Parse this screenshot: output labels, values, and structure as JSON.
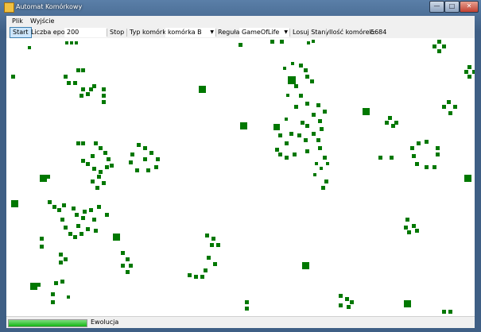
{
  "window": {
    "title": "Automat Komórkowy",
    "minimize_glyph": "—",
    "maximize_glyph": "□",
    "close_glyph": "✕"
  },
  "menu": {
    "items": [
      "Plik",
      "Wyjście"
    ]
  },
  "toolbar": {
    "start_label": "Start",
    "epochs_label": "Liczba epok:",
    "epochs_value": "200",
    "stop_label": "Stop",
    "cell_type_label": "Typ komórki:",
    "cell_type_value": "komórka B",
    "rule_label": "Reguła:",
    "rule_value": "GameOfLife",
    "randomize_label": "Losuj Stany",
    "cell_count_label": "Ilość komórek:",
    "cell_count_value": "5684"
  },
  "grid": {
    "cell_color": "#007800",
    "cells": [
      [
        80,
        4,
        4
      ],
      [
        86,
        4,
        4
      ],
      [
        74,
        4,
        4
      ],
      [
        6,
        46,
        5
      ],
      [
        27,
        10,
        4
      ],
      [
        292,
        6,
        5
      ],
      [
        332,
        2,
        5
      ],
      [
        344,
        2,
        5
      ],
      [
        378,
        4,
        4
      ],
      [
        384,
        2,
        4
      ],
      [
        542,
        2,
        5
      ],
      [
        536,
        8,
        5
      ],
      [
        542,
        14,
        5
      ],
      [
        548,
        8,
        5
      ],
      [
        580,
        34,
        5
      ],
      [
        576,
        40,
        5
      ],
      [
        586,
        40,
        5
      ],
      [
        580,
        46,
        5
      ],
      [
        88,
        38,
        5
      ],
      [
        94,
        38,
        5
      ],
      [
        72,
        46,
        5
      ],
      [
        84,
        54,
        5
      ],
      [
        108,
        58,
        5
      ],
      [
        94,
        62,
        5
      ],
      [
        104,
        62,
        5
      ],
      [
        92,
        70,
        5
      ],
      [
        100,
        68,
        5
      ],
      [
        120,
        62,
        5
      ],
      [
        120,
        70,
        5
      ],
      [
        120,
        78,
        5
      ],
      [
        76,
        54,
        5
      ],
      [
        242,
        60,
        9
      ],
      [
        348,
        36,
        4
      ],
      [
        358,
        30,
        4
      ],
      [
        368,
        32,
        5
      ],
      [
        374,
        38,
        5
      ],
      [
        354,
        48,
        10
      ],
      [
        376,
        46,
        5
      ],
      [
        382,
        52,
        5
      ],
      [
        362,
        58,
        5
      ],
      [
        352,
        70,
        4
      ],
      [
        368,
        70,
        5
      ],
      [
        376,
        80,
        5
      ],
      [
        390,
        82,
        5
      ],
      [
        398,
        90,
        5
      ],
      [
        362,
        84,
        5
      ],
      [
        350,
        100,
        4
      ],
      [
        336,
        108,
        8
      ],
      [
        342,
        120,
        5
      ],
      [
        356,
        118,
        5
      ],
      [
        370,
        104,
        5
      ],
      [
        366,
        120,
        5
      ],
      [
        384,
        94,
        5
      ],
      [
        376,
        108,
        5
      ],
      [
        392,
        102,
        5
      ],
      [
        384,
        118,
        5
      ],
      [
        394,
        112,
        5
      ],
      [
        390,
        126,
        5
      ],
      [
        374,
        126,
        5
      ],
      [
        350,
        130,
        5
      ],
      [
        338,
        138,
        5
      ],
      [
        342,
        144,
        5
      ],
      [
        350,
        148,
        5
      ],
      [
        360,
        144,
        5
      ],
      [
        376,
        140,
        5
      ],
      [
        392,
        136,
        5
      ],
      [
        398,
        148,
        5
      ],
      [
        388,
        156,
        4
      ],
      [
        402,
        156,
        4
      ],
      [
        394,
        162,
        4
      ],
      [
        386,
        170,
        4
      ],
      [
        400,
        178,
        5
      ],
      [
        396,
        186,
        5
      ],
      [
        294,
        106,
        9
      ],
      [
        448,
        88,
        9
      ],
      [
        480,
        98,
        5
      ],
      [
        488,
        104,
        5
      ],
      [
        476,
        104,
        5
      ],
      [
        484,
        108,
        5
      ],
      [
        554,
        78,
        5
      ],
      [
        562,
        84,
        5
      ],
      [
        548,
        84,
        5
      ],
      [
        556,
        92,
        5
      ],
      [
        468,
        148,
        5
      ],
      [
        482,
        148,
        5
      ],
      [
        516,
        130,
        5
      ],
      [
        526,
        128,
        5
      ],
      [
        540,
        136,
        5
      ],
      [
        540,
        144,
        5
      ],
      [
        508,
        136,
        5
      ],
      [
        510,
        146,
        5
      ],
      [
        514,
        156,
        5
      ],
      [
        526,
        160,
        5
      ],
      [
        536,
        160,
        5
      ],
      [
        576,
        172,
        9
      ],
      [
        88,
        130,
        5
      ],
      [
        94,
        130,
        5
      ],
      [
        110,
        130,
        5
      ],
      [
        116,
        136,
        5
      ],
      [
        122,
        142,
        5
      ],
      [
        126,
        150,
        5
      ],
      [
        130,
        158,
        5
      ],
      [
        106,
        146,
        5
      ],
      [
        94,
        152,
        5
      ],
      [
        100,
        156,
        5
      ],
      [
        108,
        162,
        5
      ],
      [
        116,
        166,
        5
      ],
      [
        124,
        160,
        5
      ],
      [
        114,
        172,
        5
      ],
      [
        120,
        180,
        5
      ],
      [
        106,
        178,
        5
      ],
      [
        112,
        186,
        5
      ],
      [
        164,
        132,
        5
      ],
      [
        172,
        136,
        5
      ],
      [
        180,
        142,
        5
      ],
      [
        188,
        150,
        5
      ],
      [
        186,
        160,
        5
      ],
      [
        176,
        164,
        5
      ],
      [
        162,
        164,
        5
      ],
      [
        154,
        154,
        5
      ],
      [
        156,
        144,
        5
      ],
      [
        172,
        150,
        5
      ],
      [
        42,
        172,
        9
      ],
      [
        50,
        172,
        5
      ],
      [
        6,
        204,
        9
      ],
      [
        52,
        204,
        5
      ],
      [
        58,
        210,
        5
      ],
      [
        70,
        208,
        5
      ],
      [
        64,
        214,
        5
      ],
      [
        82,
        212,
        5
      ],
      [
        86,
        220,
        5
      ],
      [
        96,
        216,
        5
      ],
      [
        104,
        214,
        5
      ],
      [
        114,
        210,
        5
      ],
      [
        124,
        220,
        5
      ],
      [
        108,
        226,
        5
      ],
      [
        94,
        224,
        5
      ],
      [
        88,
        234,
        5
      ],
      [
        100,
        238,
        5
      ],
      [
        110,
        240,
        5
      ],
      [
        92,
        244,
        5
      ],
      [
        68,
        226,
        5
      ],
      [
        72,
        236,
        5
      ],
      [
        78,
        244,
        5
      ],
      [
        84,
        248,
        5
      ],
      [
        134,
        246,
        9
      ],
      [
        502,
        226,
        5
      ],
      [
        510,
        234,
        5
      ],
      [
        504,
        242,
        5
      ],
      [
        500,
        236,
        5
      ],
      [
        514,
        240,
        5
      ],
      [
        42,
        250,
        5
      ],
      [
        42,
        260,
        5
      ],
      [
        66,
        270,
        5
      ],
      [
        72,
        276,
        5
      ],
      [
        66,
        280,
        5
      ],
      [
        144,
        268,
        5
      ],
      [
        150,
        276,
        5
      ],
      [
        144,
        284,
        5
      ],
      [
        154,
        284,
        5
      ],
      [
        150,
        292,
        5
      ],
      [
        250,
        246,
        5
      ],
      [
        258,
        250,
        5
      ],
      [
        264,
        258,
        5
      ],
      [
        256,
        258,
        5
      ],
      [
        252,
        274,
        5
      ],
      [
        260,
        282,
        5
      ],
      [
        248,
        290,
        5
      ],
      [
        236,
        298,
        5
      ],
      [
        244,
        298,
        5
      ],
      [
        228,
        296,
        5
      ],
      [
        372,
        282,
        9
      ],
      [
        30,
        308,
        9
      ],
      [
        38,
        308,
        5
      ],
      [
        60,
        306,
        5
      ],
      [
        68,
        304,
        5
      ],
      [
        56,
        320,
        5
      ],
      [
        56,
        330,
        5
      ],
      [
        76,
        324,
        4
      ],
      [
        300,
        330,
        5
      ],
      [
        300,
        338,
        5
      ],
      [
        418,
        322,
        5
      ],
      [
        426,
        326,
        5
      ],
      [
        432,
        330,
        5
      ],
      [
        418,
        334,
        5
      ],
      [
        428,
        336,
        5
      ],
      [
        500,
        330,
        9
      ],
      [
        548,
        342,
        5
      ],
      [
        556,
        342,
        5
      ]
    ]
  },
  "status": {
    "progress": 1.0,
    "label": "Ewolucja"
  }
}
